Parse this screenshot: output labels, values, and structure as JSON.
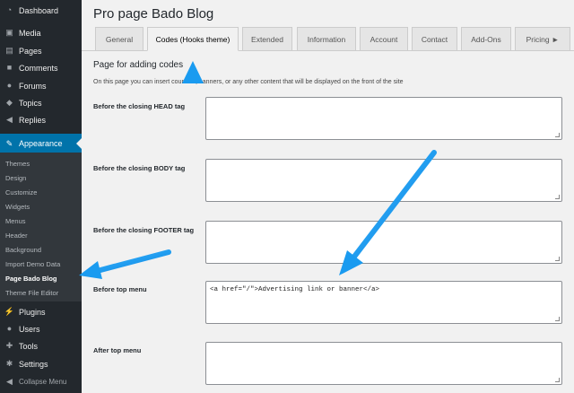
{
  "sidebar": {
    "top_items": [
      {
        "label": "Dashboard",
        "icon": "dashboard-icon",
        "glyph": "◔"
      },
      {
        "label": "Media",
        "icon": "media-icon",
        "glyph": "▣"
      },
      {
        "label": "Pages",
        "icon": "pages-icon",
        "glyph": "▤"
      },
      {
        "label": "Comments",
        "icon": "comments-icon",
        "glyph": "■"
      },
      {
        "label": "Forums",
        "icon": "forums-icon",
        "glyph": "●"
      },
      {
        "label": "Topics",
        "icon": "topics-icon",
        "glyph": "◆"
      },
      {
        "label": "Replies",
        "icon": "replies-icon",
        "glyph": "◀"
      }
    ],
    "appearance": {
      "label": "Appearance",
      "icon": "paintbrush-icon",
      "glyph": "✎"
    },
    "submenu": [
      "Themes",
      "Design",
      "Customize",
      "Widgets",
      "Menus",
      "Header",
      "Background",
      "Import Demo Data",
      "Page Bado Blog",
      "Theme File Editor"
    ],
    "bottom_items": [
      {
        "label": "Plugins",
        "icon": "plugins-icon",
        "glyph": "⚡"
      },
      {
        "label": "Users",
        "icon": "users-icon",
        "glyph": "●"
      },
      {
        "label": "Tools",
        "icon": "tools-icon",
        "glyph": "✚"
      },
      {
        "label": "Settings",
        "icon": "settings-icon",
        "glyph": "✱"
      },
      {
        "label": "Collapse Menu",
        "icon": "collapse-icon",
        "glyph": "◀"
      }
    ]
  },
  "page": {
    "title": "Pro page Bado Blog",
    "tabs": [
      "General",
      "Codes (Hooks theme)",
      "Extended",
      "Information",
      "Account",
      "Contact",
      "Add-Ons",
      "Pricing ►"
    ],
    "active_tab": "Codes (Hooks theme)",
    "section_title": "Page for adding codes",
    "section_desc": "On this page you can insert counters, banners, or any other content that will be displayed on the front of the site",
    "fields": [
      {
        "label": "Before the closing HEAD tag",
        "value": ""
      },
      {
        "label": "Before the closing BODY tag",
        "value": ""
      },
      {
        "label": "Before the closing FOOTER tag",
        "value": ""
      },
      {
        "label": "Before top menu",
        "value": "<a href=\"/\">Advertising link or banner</a>"
      },
      {
        "label": "After top menu",
        "value": ""
      }
    ]
  },
  "colors": {
    "sidebar": "#23282d",
    "active": "#0073aa",
    "arrow": "#1a9bf0"
  }
}
